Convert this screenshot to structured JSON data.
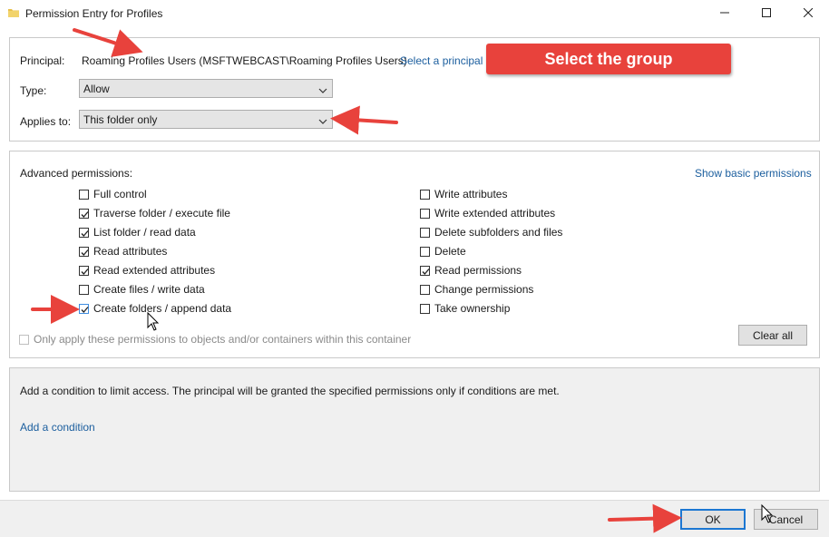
{
  "window": {
    "title": "Permission Entry for Profiles",
    "icons": {
      "app": "folder-icon",
      "minimize": "minimize-icon",
      "maximize": "maximize-icon",
      "close": "close-icon"
    }
  },
  "principal_section": {
    "principal_label": "Principal:",
    "principal_value": "Roaming Profiles Users (MSFTWEBCAST\\Roaming Profiles Users)",
    "select_principal_link": "Select a principal",
    "type_label": "Type:",
    "type_value": "Allow",
    "applies_label": "Applies to:",
    "applies_value": "This folder only"
  },
  "annotation": {
    "callout_text": "Select the group",
    "callout_color": "#e8423c"
  },
  "permissions_section": {
    "heading": "Advanced permissions:",
    "show_basic_link": "Show basic permissions",
    "left_column": [
      {
        "label": "Full control",
        "checked": false
      },
      {
        "label": "Traverse folder / execute file",
        "checked": true
      },
      {
        "label": "List folder / read data",
        "checked": true
      },
      {
        "label": "Read attributes",
        "checked": true
      },
      {
        "label": "Read extended attributes",
        "checked": true
      },
      {
        "label": "Create files / write data",
        "checked": false
      },
      {
        "label": "Create folders / append data",
        "checked": true
      }
    ],
    "right_column": [
      {
        "label": "Write attributes",
        "checked": false
      },
      {
        "label": "Write extended attributes",
        "checked": false
      },
      {
        "label": "Delete subfolders and files",
        "checked": false
      },
      {
        "label": "Delete",
        "checked": false
      },
      {
        "label": "Read permissions",
        "checked": true
      },
      {
        "label": "Change permissions",
        "checked": false
      },
      {
        "label": "Take ownership",
        "checked": false
      }
    ],
    "only_apply_label": "Only apply these permissions to objects and/or containers within this container",
    "clear_all_label": "Clear all"
  },
  "condition_section": {
    "text": "Add a condition to limit access. The principal will be granted the specified permissions only if conditions are met.",
    "add_condition_link": "Add a condition"
  },
  "footer": {
    "ok_label": "OK",
    "cancel_label": "Cancel"
  },
  "colors": {
    "link": "#1b5e9e",
    "accent": "#1c77d2",
    "arrow": "#e8423c"
  }
}
